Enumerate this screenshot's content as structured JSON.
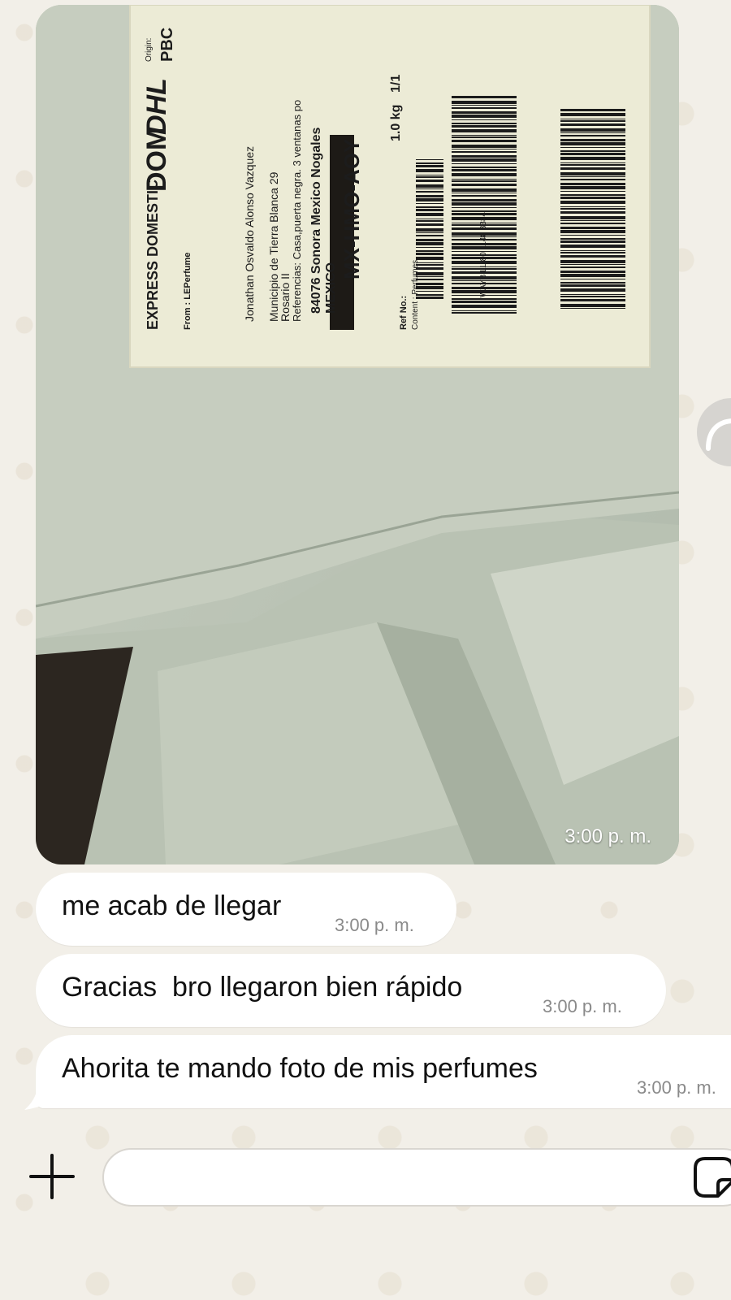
{
  "photo_message": {
    "time": "3:00 p. m.",
    "label_text": {
      "service": "EXPRESS DOMESTIC",
      "product": "DOM",
      "brand": "DHL",
      "origin_label": "Origin:",
      "origin": "PBC",
      "from": "From : LEPerfume",
      "to_name": "Jonathan Osvaldo Alonso Vazquez",
      "to_line2": "Municipio de Tierra Blanca 29",
      "to_line3": "Rosario II",
      "references": "Referencias: Casa,puerta negra. 3 ventanas po",
      "postal": "84076 Sonora Mexico Nogales",
      "country": "MEXICO",
      "route": "MX-HMO-AOY",
      "weight": "1.0 kg",
      "piece": "1/1",
      "ref_no": "Ref No.:",
      "content": "Content : Perfumes",
      "waybill": "WAYB LL 80 1148 3384"
    }
  },
  "messages": [
    {
      "text": "me acab de llegar",
      "time": "3:00 p. m."
    },
    {
      "text": "Gracias  bro llegaron bien rápido",
      "time": "3:00 p. m."
    },
    {
      "text": "Ahorita te mando foto de mis perfumes",
      "time": "3:00 p. m."
    }
  ],
  "composer": {
    "placeholder": ""
  },
  "icons": {
    "add": "plus-icon",
    "sticker": "sticker-icon",
    "side": "reply-arrow-icon"
  }
}
